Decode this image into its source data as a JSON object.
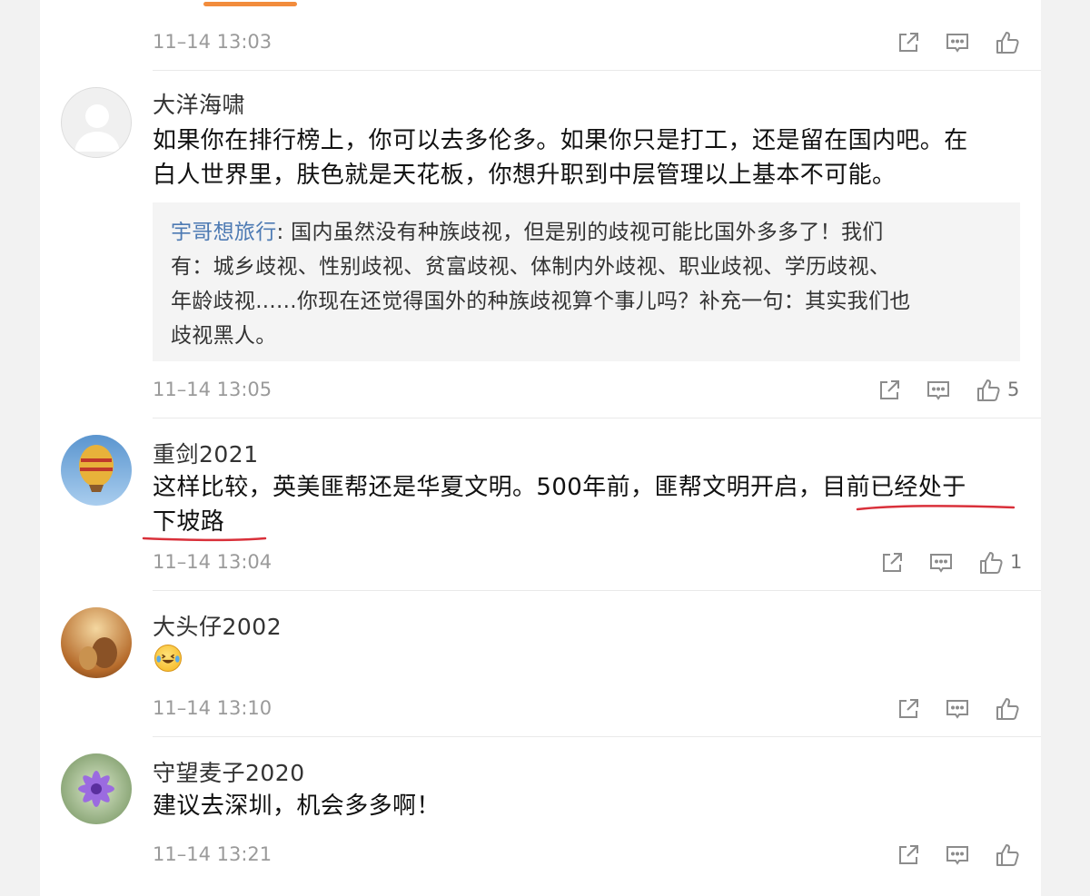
{
  "comments": [
    {
      "time": "11–14 13:03"
    },
    {
      "username": "大洋海啸",
      "line1": "如果你在排行榜上，你可以去多伦多。如果你只是打工，还是留在国内吧。在",
      "line2": "白人世界里，肤色就是天花板，你想升职到中层管理以上基本不可能。",
      "quote": {
        "user": "宇哥想旅行",
        "line1": ": 国内虽然没有种族歧视，但是别的歧视可能比国外多多了！我们",
        "line2": "有：城乡歧视、性别歧视、贫富歧视、体制内外歧视、职业歧视、学历歧视、",
        "line3": "年龄歧视......你现在还觉得国外的种族歧视算个事儿吗？补充一句：其实我们也",
        "line4": "歧视黑人。"
      },
      "time": "11–14 13:05",
      "likes": "5"
    },
    {
      "username": "重剑2021",
      "line1": "这样比较，英美匪帮还是华夏文明。500年前，匪帮文明开启，目前已经处于",
      "line2": "下坡路",
      "time": "11–14 13:04",
      "likes": "1"
    },
    {
      "username": "大头仔2002",
      "emoji": "laughing-tears-emoji",
      "time": "11–14 13:10"
    },
    {
      "username": "守望麦子2020",
      "line1": "建议去深圳，机会多多啊！",
      "time": "11–14 13:21"
    }
  ],
  "icons": {
    "share": "share-icon",
    "comment": "comment-icon",
    "like": "like-icon"
  },
  "colors": {
    "quote_user": "#4d7ab3",
    "annotation": "#d9303a",
    "top_indicator": "#f28c3c"
  }
}
